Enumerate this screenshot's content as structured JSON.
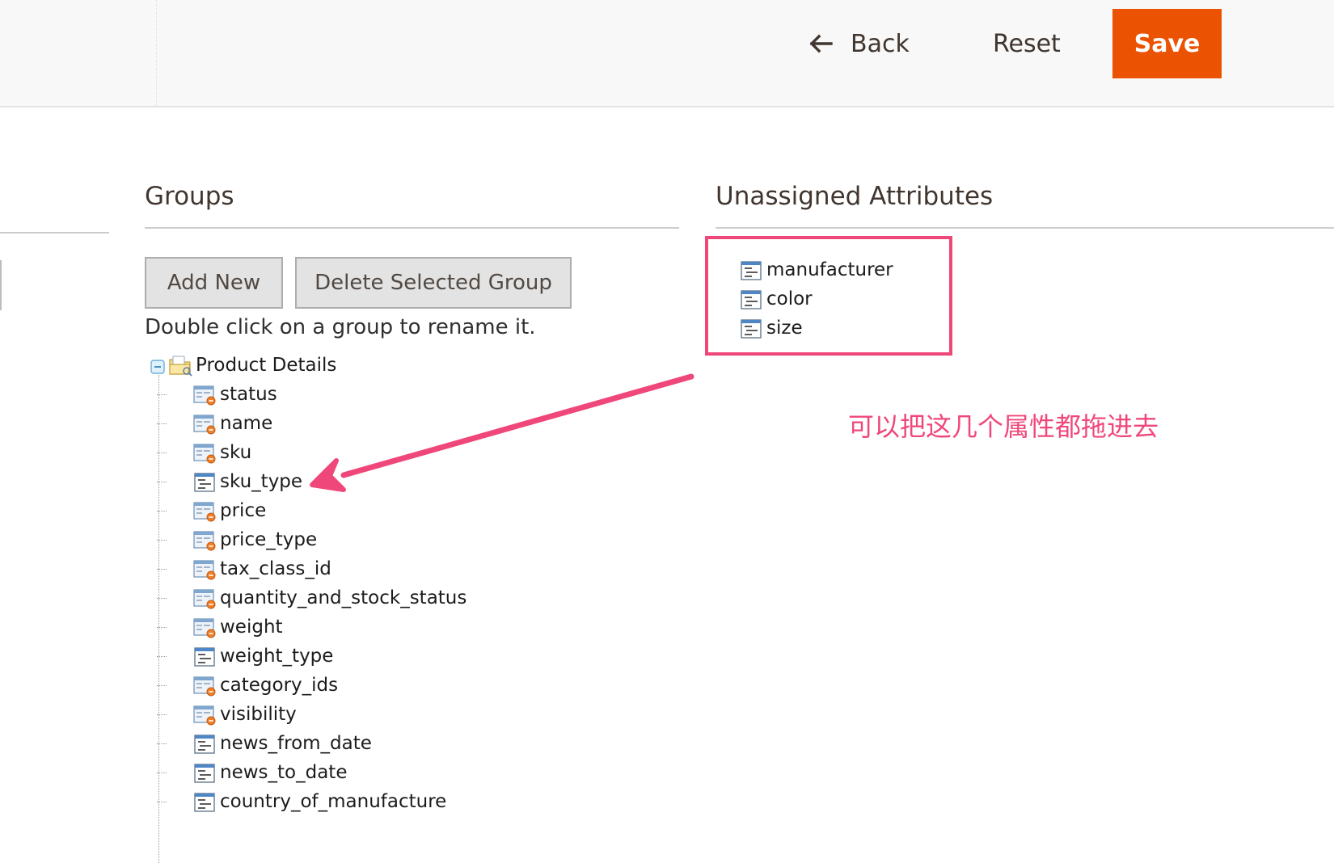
{
  "toolbar": {
    "back_label": "Back",
    "reset_label": "Reset",
    "save_label": "Save",
    "save_color": "#eb5202"
  },
  "groups": {
    "title": "Groups",
    "add_new_label": "Add New",
    "delete_label": "Delete Selected Group",
    "hint": "Double click on a group to rename it.",
    "tree": {
      "group_name": "Product Details",
      "group_icon": "folder-icon",
      "toggle_icon": "collapse-minus-icon",
      "attributes": [
        {
          "name": "status",
          "icon": "system-attribute-icon"
        },
        {
          "name": "name",
          "icon": "system-attribute-icon"
        },
        {
          "name": "sku",
          "icon": "system-attribute-icon"
        },
        {
          "name": "sku_type",
          "icon": "attribute-icon"
        },
        {
          "name": "price",
          "icon": "system-attribute-icon"
        },
        {
          "name": "price_type",
          "icon": "system-attribute-icon"
        },
        {
          "name": "tax_class_id",
          "icon": "system-attribute-icon"
        },
        {
          "name": "quantity_and_stock_status",
          "icon": "system-attribute-icon"
        },
        {
          "name": "weight",
          "icon": "system-attribute-icon"
        },
        {
          "name": "weight_type",
          "icon": "attribute-icon"
        },
        {
          "name": "category_ids",
          "icon": "system-attribute-icon"
        },
        {
          "name": "visibility",
          "icon": "system-attribute-icon"
        },
        {
          "name": "news_from_date",
          "icon": "attribute-icon"
        },
        {
          "name": "news_to_date",
          "icon": "attribute-icon"
        },
        {
          "name": "country_of_manufacture",
          "icon": "attribute-icon"
        }
      ]
    }
  },
  "unassigned": {
    "title": "Unassigned Attributes",
    "attributes": [
      {
        "name": "manufacturer",
        "icon": "attribute-icon"
      },
      {
        "name": "color",
        "icon": "attribute-icon"
      },
      {
        "name": "size",
        "icon": "attribute-icon"
      }
    ]
  },
  "annotation": {
    "text": "可以把这几个属性都拖进去",
    "color": "#f0477a"
  }
}
